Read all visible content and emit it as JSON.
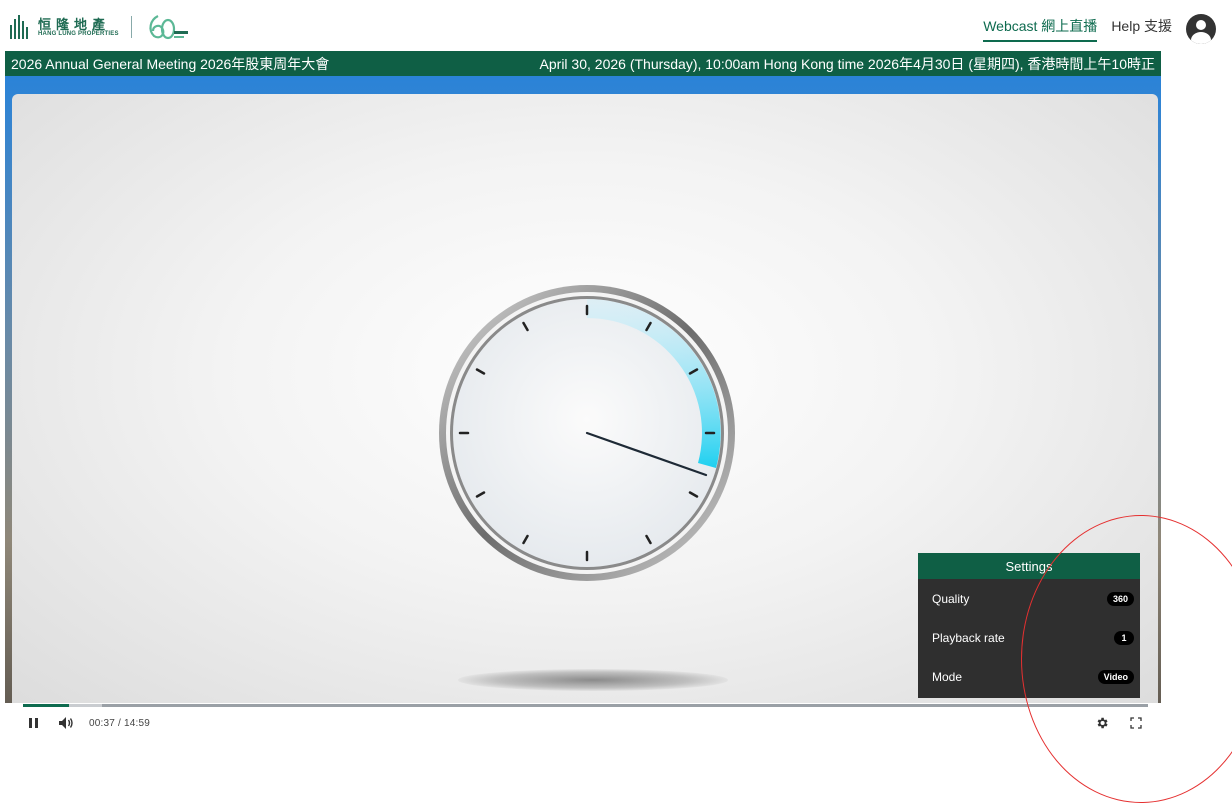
{
  "header": {
    "logo_cn": "恒隆地產",
    "logo_en": "HANG LUNG PROPERTIES",
    "nav": [
      {
        "label": "Webcast 網上直播",
        "active": true
      },
      {
        "label": "Help 支援",
        "active": false
      }
    ]
  },
  "event": {
    "title": "2026 Annual General Meeting 2026年股東周年大會",
    "datetime": "April 30, 2026 (Thursday), 10:00am Hong Kong time 2026年4月30日 (星期四), 香港時間上午10時正"
  },
  "player": {
    "current_time": "00:37",
    "separator": "/",
    "duration": "14:59",
    "progress": 0.041,
    "buffered": 0.07
  },
  "settings": {
    "title": "Settings",
    "rows": [
      {
        "label": "Quality",
        "value": "360"
      },
      {
        "label": "Playback rate",
        "value": "1"
      },
      {
        "label": "Mode",
        "value": "Video"
      }
    ]
  },
  "icons": {
    "pause": "pause-icon",
    "volume": "volume-icon",
    "gear": "gear-icon",
    "fullscreen": "fullscreen-icon",
    "user": "user-avatar-icon"
  },
  "colors": {
    "brand_green": "#0f5f45",
    "settings_bg": "#2f2f2f",
    "accent_cyan": "#22c4e8"
  }
}
